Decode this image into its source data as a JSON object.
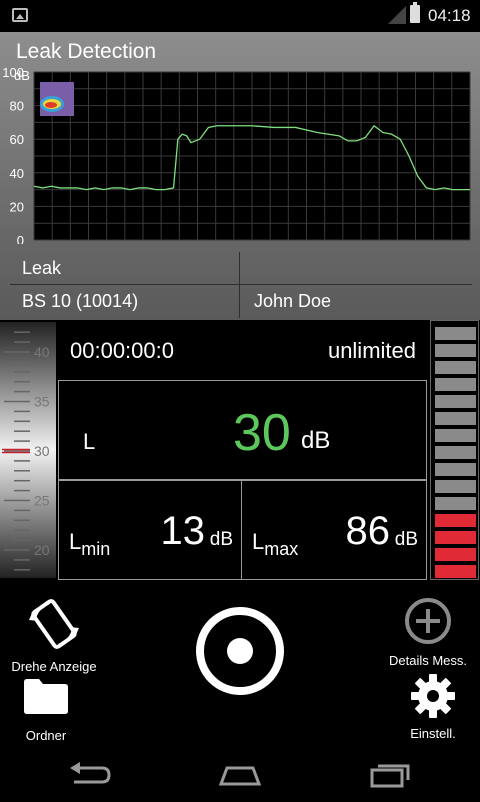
{
  "status_bar": {
    "time": "04:18"
  },
  "header": {
    "title": "Leak Detection"
  },
  "chart_data": {
    "type": "line",
    "ylabel": "dB",
    "ylim": [
      0,
      100
    ],
    "yticks": [
      "0",
      "20",
      "40",
      "60",
      "80",
      "100"
    ],
    "grid": true,
    "series": [
      {
        "x": [
          0,
          2,
          4,
          6,
          8,
          10,
          12,
          14,
          16,
          18,
          20,
          22,
          24,
          26,
          28,
          30,
          32,
          33,
          34,
          35,
          36,
          38,
          40,
          42,
          44,
          46,
          50,
          55,
          60,
          65,
          70,
          72,
          74,
          76,
          78,
          80,
          82,
          84,
          86,
          88,
          90,
          92,
          94,
          96,
          98,
          100
        ],
        "y": [
          32,
          31,
          32,
          31,
          31,
          31,
          30,
          31,
          30,
          31,
          31,
          30,
          31,
          31,
          30,
          30,
          31,
          60,
          63,
          62,
          58,
          60,
          67,
          68,
          68,
          68,
          68,
          67,
          67,
          64,
          62,
          59,
          59,
          61,
          68,
          64,
          63,
          60,
          50,
          38,
          31,
          30,
          31,
          30,
          30,
          30
        ]
      }
    ]
  },
  "info": {
    "row1": {
      "left": "Leak",
      "right": ""
    },
    "row2": {
      "left": "BS 10 (10014)",
      "right": "John Doe"
    }
  },
  "ruler": {
    "labels": [
      "40",
      "35",
      "30",
      "25",
      "20"
    ]
  },
  "readout": {
    "timer": "00:00:00:0",
    "duration": "unlimited",
    "main_label": "L",
    "main_value": "30",
    "unit": "dB",
    "min_label": "L",
    "min_sub": "min",
    "min_value": "13",
    "max_label": "L",
    "max_sub": "max",
    "max_value": "86"
  },
  "meter": {
    "segments": 15,
    "active_segments": 4,
    "active_color": "#e02a35",
    "inactive_color": "#8a8a8a"
  },
  "controls": {
    "rotate": {
      "label": "Drehe Anzeige",
      "icon": "rotate-screen-icon"
    },
    "details": {
      "label": "Details Mess.",
      "icon": "plus-circle-icon"
    },
    "folder": {
      "label": "Ordner",
      "icon": "folder-icon"
    },
    "settings": {
      "label": "Einstell.",
      "icon": "gear-icon"
    },
    "record": {
      "icon": "record-icon"
    }
  },
  "colors": {
    "accent_green": "#5cc85c",
    "chart_line": "#7ee07e",
    "alarm_red": "#e02a35"
  }
}
